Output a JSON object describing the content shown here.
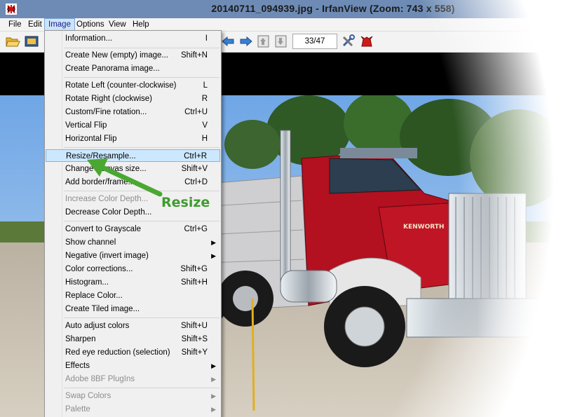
{
  "window": {
    "title": "20140711_094939.jpg - IrfanView (Zoom: 743 x 558)"
  },
  "menubar": {
    "items": [
      {
        "label": "File"
      },
      {
        "label": "Edit"
      },
      {
        "label": "Image"
      },
      {
        "label": "Options"
      },
      {
        "label": "View"
      },
      {
        "label": "Help"
      }
    ],
    "active": "Image"
  },
  "toolbar": {
    "page_counter": "33/47"
  },
  "image_menu": {
    "items": [
      {
        "label": "Information...",
        "shortcut": "I"
      },
      {
        "label": "Create New (empty) image...",
        "shortcut": "Shift+N"
      },
      {
        "label": "Create Panorama image...",
        "shortcut": ""
      },
      {
        "label": "Rotate Left (counter-clockwise)",
        "shortcut": "L"
      },
      {
        "label": "Rotate Right (clockwise)",
        "shortcut": "R"
      },
      {
        "label": "Custom/Fine rotation...",
        "shortcut": "Ctrl+U"
      },
      {
        "label": "Vertical Flip",
        "shortcut": "V"
      },
      {
        "label": "Horizontal Flip",
        "shortcut": "H"
      },
      {
        "label": "Resize/Resample...",
        "shortcut": "Ctrl+R"
      },
      {
        "label": "Change Canvas size...",
        "shortcut": "Shift+V"
      },
      {
        "label": "Add border/frame...",
        "shortcut": "Ctrl+D"
      },
      {
        "label": "Increase Color Depth...",
        "shortcut": ""
      },
      {
        "label": "Decrease Color Depth...",
        "shortcut": ""
      },
      {
        "label": "Convert to Grayscale",
        "shortcut": "Ctrl+G"
      },
      {
        "label": "Show channel",
        "shortcut": ""
      },
      {
        "label": "Negative (invert image)",
        "shortcut": ""
      },
      {
        "label": "Color corrections...",
        "shortcut": "Shift+G"
      },
      {
        "label": "Histogram...",
        "shortcut": "Shift+H"
      },
      {
        "label": "Replace Color...",
        "shortcut": ""
      },
      {
        "label": "Create Tiled image...",
        "shortcut": ""
      },
      {
        "label": "Auto adjust colors",
        "shortcut": "Shift+U"
      },
      {
        "label": "Sharpen",
        "shortcut": "Shift+S"
      },
      {
        "label": "Red eye reduction (selection)",
        "shortcut": "Shift+Y"
      },
      {
        "label": "Effects",
        "shortcut": ""
      },
      {
        "label": "Adobe 8BF PlugIns",
        "shortcut": ""
      },
      {
        "label": "Swap Colors",
        "shortcut": ""
      },
      {
        "label": "Palette",
        "shortcut": ""
      }
    ],
    "highlighted": "Resize/Resample..."
  },
  "annotation": {
    "text": "Resize",
    "color": "#3f9b2e"
  },
  "photo": {
    "truck_brand": "KENWORTH"
  },
  "icons": [
    "open-folder-icon",
    "slideshow-icon",
    "prev-arrow-icon",
    "next-arrow-icon",
    "first-page-icon",
    "last-page-icon",
    "settings-tools-icon",
    "irfanview-cat-icon"
  ],
  "colors": {
    "menu_highlight": "#cce8ff",
    "titlebar": "#6d8bb5",
    "truck_red": "#b31020"
  }
}
